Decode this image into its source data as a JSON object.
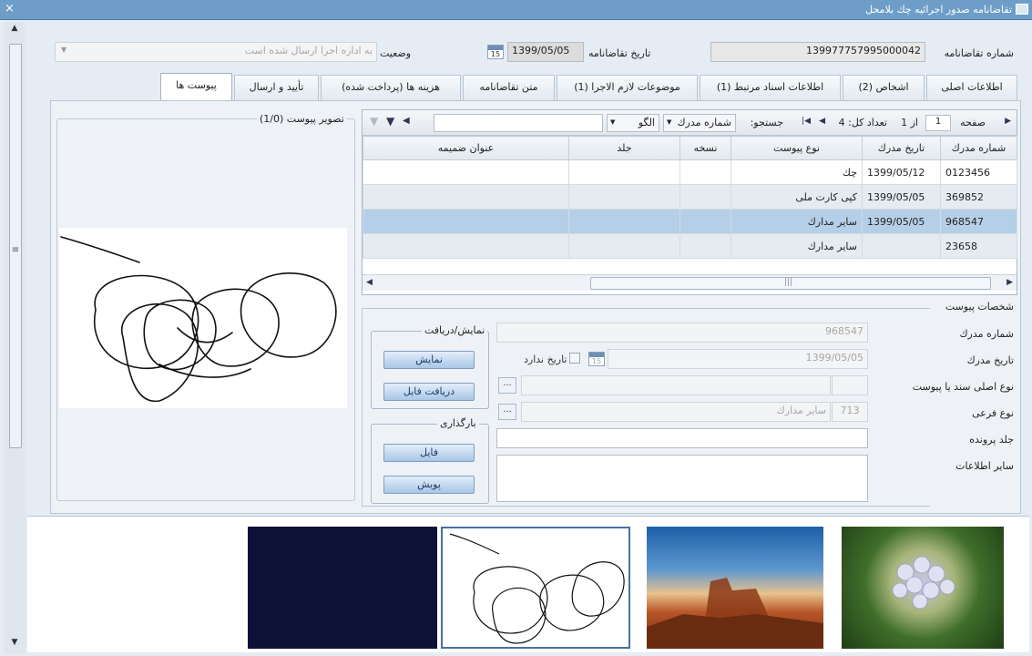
{
  "window": {
    "title": "تقاضانامه صدور اجرائیه چك بلامحل",
    "close": "×"
  },
  "header": {
    "request_no_label": "شماره تقاضانامه",
    "request_no_value": "139977757995000042",
    "request_date_label": "تاریخ تقاضانامه",
    "request_date_value": "1399/05/05",
    "calendar_icon_text": "15",
    "status_label": "وضعیت",
    "status_value": "به اداره اجرا ارسال شده است"
  },
  "tabs": [
    {
      "label": "اطلاعات اصلی"
    },
    {
      "label": "اشخاص (2)"
    },
    {
      "label": "اطلاعات اسناد مرتبط (1)"
    },
    {
      "label": "موضوعات لازم الاجرا (1)"
    },
    {
      "label": "متن تقاضانامه"
    },
    {
      "label": "هزینه ها (پرداخت شده)"
    },
    {
      "label": "تأیید و ارسال"
    },
    {
      "label": "پیوست ها"
    }
  ],
  "pager": {
    "page_label": "صفحه",
    "page_value": "1",
    "of_label": "از 1",
    "total_label": "تعداد کل: 4",
    "search_label": "جستجو:",
    "search_field": "شماره مدرك",
    "search_mode": "الگو"
  },
  "grid": {
    "columns": [
      "شماره مدرك",
      "تاریخ مدرك",
      "نوع پیوست",
      "نسخه",
      "جلد",
      "عنوان ضمیمه"
    ],
    "rows": [
      [
        "0123456",
        "1399/05/12",
        "چك",
        "",
        "",
        ""
      ],
      [
        "369852",
        "1399/05/05",
        "کپی کارت ملی",
        "",
        "",
        ""
      ],
      [
        "968547",
        "1399/05/05",
        "سایر مدارك",
        "",
        "",
        ""
      ],
      [
        "23658",
        "",
        "سایر مدارك",
        "",
        "",
        ""
      ]
    ],
    "selected_index": 2
  },
  "preview": {
    "title": "تصویر پیوست (1/0)"
  },
  "properties": {
    "section_title": "شخصات پیوست",
    "doc_no_label": "شماره مدرك",
    "doc_no_value": "968547",
    "doc_date_label": "تاریخ مدرك",
    "doc_date_value": "1399/05/05",
    "no_date_label": "تاریخ ندارد",
    "main_type_label": "نوع اصلی سند یا پیوست",
    "sub_type_label": "نوع فرعی",
    "sub_type_code": "713",
    "sub_type_value": "سایر مدارك",
    "volume_label": "جلد پرونده",
    "other_info_label": "سایر اطلاعات",
    "dots": "..."
  },
  "view_group": {
    "title": "نمایش/دریافت",
    "show_button": "نمایش",
    "download_button": "دریافت فایل"
  },
  "upload_group": {
    "title": "بارگذاری",
    "file_button": "فایل",
    "scan_button": "پویش"
  },
  "colors": {
    "titlebar": "#6e9ec8",
    "selected_row": "#b6cfe8",
    "button_text": "#1f3f66"
  }
}
